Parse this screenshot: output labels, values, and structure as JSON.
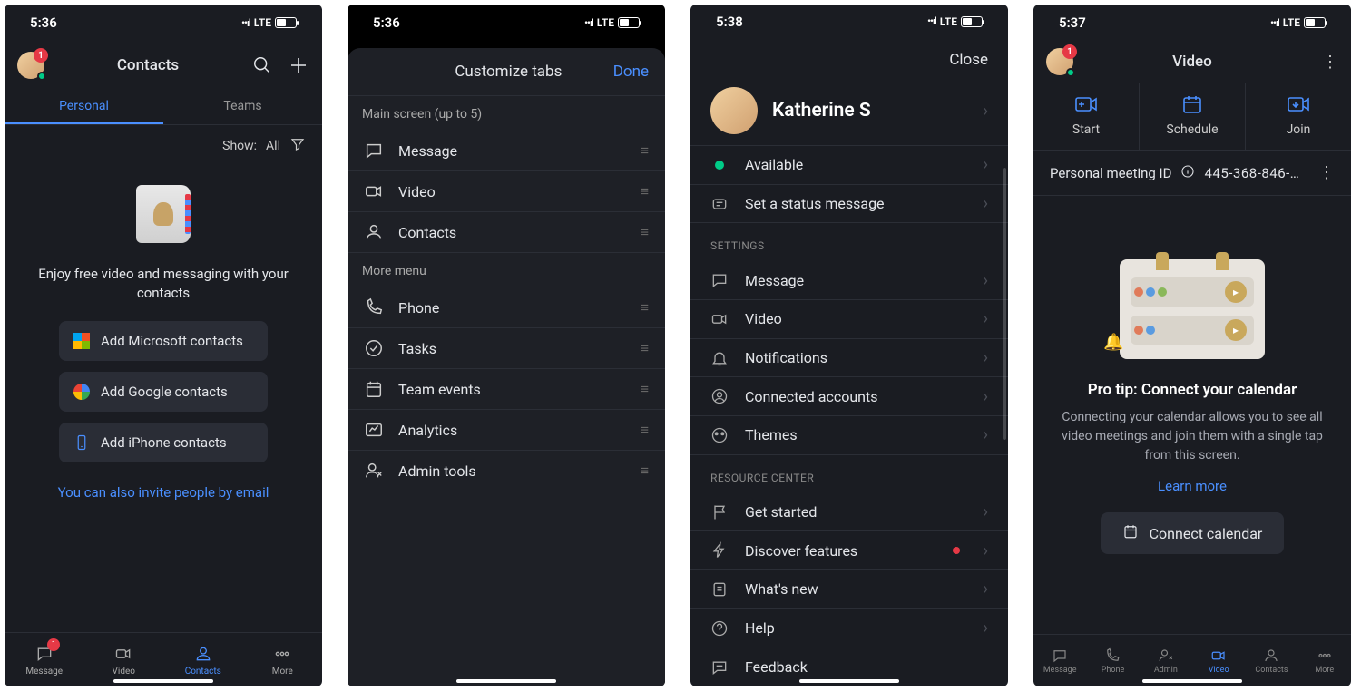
{
  "s1": {
    "time": "5:36",
    "net": "LTE",
    "header": {
      "title": "Contacts",
      "badge": "1"
    },
    "tabs": {
      "personal": "Personal",
      "teams": "Teams"
    },
    "filter": {
      "label": "Show:",
      "value": "All"
    },
    "empty_msg": "Enjoy free video and messaging with your contacts",
    "add": {
      "ms": "Add Microsoft contacts",
      "goog": "Add Google contacts",
      "iph": "Add iPhone contacts"
    },
    "invite": "You can also invite people by email",
    "tabbar": {
      "msg": "Message",
      "video": "Video",
      "contacts": "Contacts",
      "more": "More",
      "msg_badge": "1"
    }
  },
  "s2": {
    "time": "5:36",
    "net": "LTE",
    "title": "Customize tabs",
    "done": "Done",
    "group1": "Main screen (up to 5)",
    "group2": "More menu",
    "items1": [
      "Message",
      "Video",
      "Contacts"
    ],
    "items2": [
      "Phone",
      "Tasks",
      "Team events",
      "Analytics",
      "Admin tools"
    ]
  },
  "s3": {
    "time": "5:38",
    "net": "LTE",
    "close": "Close",
    "name": "Katherine S",
    "status": "Available",
    "set_status": "Set a status message",
    "sect_settings": "SETTINGS",
    "settings": [
      "Message",
      "Video",
      "Notifications",
      "Connected accounts",
      "Themes"
    ],
    "sect_resource": "RESOURCE CENTER",
    "resource": [
      "Get started",
      "Discover features",
      "What's new",
      "Help",
      "Feedback"
    ]
  },
  "s4": {
    "time": "5:37",
    "net": "LTE",
    "header": {
      "title": "Video",
      "badge": "1"
    },
    "actions": {
      "start": "Start",
      "schedule": "Schedule",
      "join": "Join"
    },
    "pmi": {
      "label": "Personal meeting ID",
      "id": "445-368-846-…"
    },
    "tip": {
      "title": "Pro tip: Connect your calendar",
      "text": "Connecting your calendar allows you to see all video meetings and join them with a single tap from this screen.",
      "learn": "Learn more",
      "btn": "Connect calendar"
    },
    "tabbar": {
      "msg": "Message",
      "phone": "Phone",
      "admin": "Admin",
      "video": "Video",
      "contacts": "Contacts",
      "more": "More"
    }
  }
}
